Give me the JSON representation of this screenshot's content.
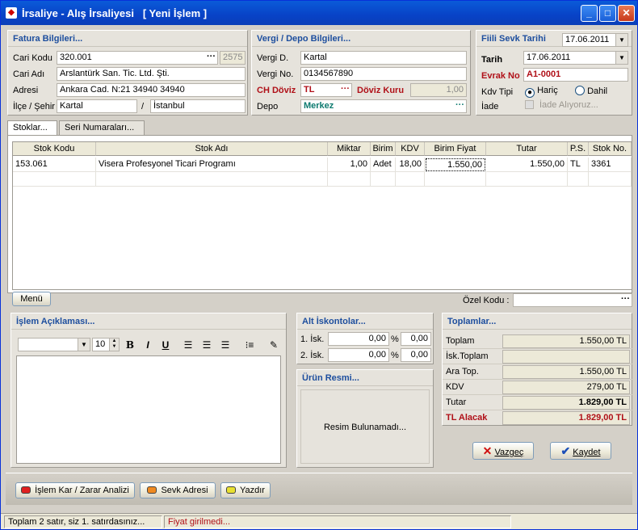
{
  "window": {
    "title": "İrsaliye - Alış İrsaliyesi   [ Yeni İşlem ]"
  },
  "fatura": {
    "header": "Fatura Bilgileri...",
    "cari_kodu_label": "Cari Kodu",
    "cari_kodu": "320.001",
    "cari_no": "2575",
    "cari_adi_label": "Cari Adı",
    "cari_adi": "Arslantürk San. Tic. Ltd. Şti.",
    "adresi_label": "Adresi",
    "adresi": "Ankara Cad. N:21   34940 34940",
    "ilce_label": "İlçe / Şehir",
    "ilce": "Kartal",
    "sep": "/",
    "sehir": "İstanbul"
  },
  "vergi": {
    "header": "Vergi / Depo Bilgileri...",
    "vergi_d_label": "Vergi D.",
    "vergi_d": "Kartal",
    "vergi_no_label": "Vergi No.",
    "vergi_no": "0134567890",
    "ch_doviz_label": "CH Döviz",
    "ch_doviz": "TL",
    "doviz_kuru_label": "Döviz Kuru",
    "doviz_kuru": "1,00",
    "depo_label": "Depo",
    "depo": "Merkez"
  },
  "sevk": {
    "fili_label": "Fiili Sevk Tarihi",
    "fili_date": "17.06.2011",
    "tarih_label": "Tarih",
    "tarih": "17.06.2011",
    "evrak_label": "Evrak No",
    "evrak": "A1-0001",
    "kdv_label": "Kdv Tipi",
    "haric": "Hariç",
    "dahil": "Dahil",
    "iade_label": "İade",
    "iade_check": "İade Alıyoruz..."
  },
  "tabs": [
    "Stoklar...",
    "Seri Numaraları..."
  ],
  "grid": {
    "headers": [
      "Stok Kodu",
      "Stok Adı",
      "Miktar",
      "Birim",
      "KDV",
      "Birim Fiyat",
      "Tutar",
      "P.S.",
      "Stok No."
    ],
    "rows": [
      [
        "153.061",
        "Visera Profesyonel Ticari Programı",
        "1,00",
        "Adet",
        "18,00",
        "1.550,00",
        "1.550,00",
        "TL",
        "3361"
      ]
    ]
  },
  "menu_button": "Menü",
  "ozel_kodu_label": "Özel Kodu :",
  "aciklama": {
    "header": "İşlem Açıklaması...",
    "font_size": "10"
  },
  "iskonto": {
    "header": "Alt İskontolar...",
    "isk1_label": "1. İsk.",
    "isk1_pct": "0,00",
    "isk1_val": "0,00",
    "isk2_label": "2. İsk.",
    "isk2_pct": "0,00",
    "isk2_val": "0,00",
    "pct": "%"
  },
  "resim": {
    "header": "Ürün Resmi...",
    "empty": "Resim Bulunamadı..."
  },
  "toplamlar": {
    "header": "Toplamlar...",
    "rows": [
      {
        "label": "Toplam",
        "value": "1.550,00 TL"
      },
      {
        "label": "İsk.Toplam",
        "value": ""
      },
      {
        "label": "Ara Top.",
        "value": "1.550,00 TL"
      },
      {
        "label": "KDV",
        "value": "279,00 TL"
      },
      {
        "label": "Tutar",
        "value": "1.829,00 TL"
      },
      {
        "label": "TL Alacak",
        "value": "1.829,00 TL"
      }
    ]
  },
  "buttons": {
    "vazgec": "Vazgeç",
    "kaydet": "Kaydet",
    "kar_zarar": "İşlem Kar / Zarar Analizi",
    "sevk_adresi": "Sevk Adresi",
    "yazdir": "Yazdır"
  },
  "status": {
    "left": "Toplam 2 satır, siz 1. satırdasınız...",
    "right": "Fiyat girilmedi..."
  },
  "colors": {
    "accent": "#1d4e9e",
    "alert": "#b01018",
    "teal": "#0d7a6f"
  }
}
